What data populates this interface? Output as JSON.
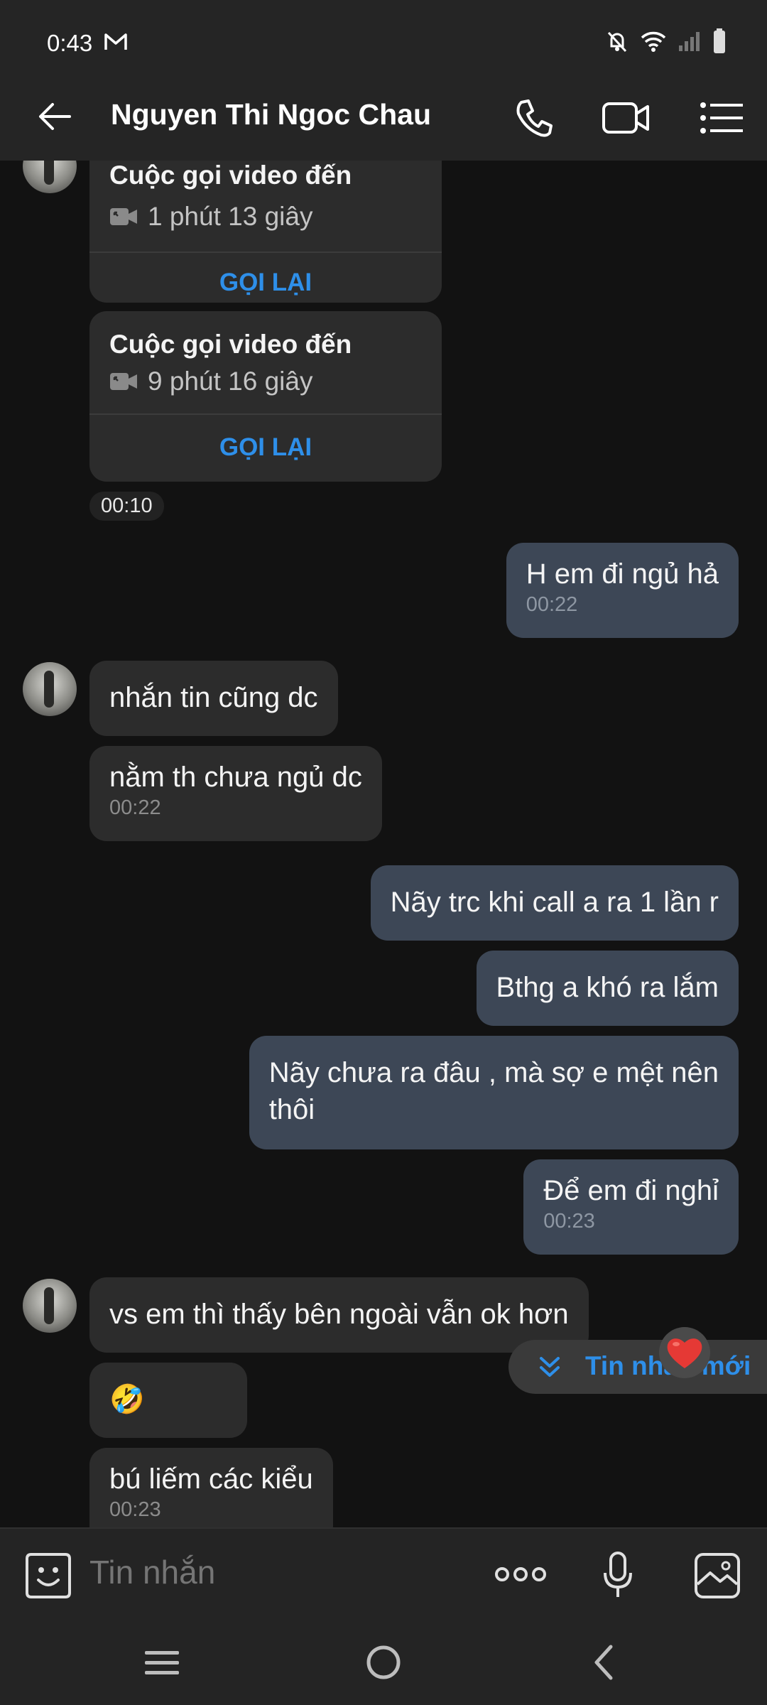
{
  "status": {
    "time": "0:43"
  },
  "header": {
    "contact_name": "Nguyen Thi Ngoc Chau"
  },
  "calls": [
    {
      "title": "Cuộc gọi video đến",
      "duration": "1 phút 13 giây",
      "action": "GỌI LẠI"
    },
    {
      "title": "Cuộc gọi video đến",
      "duration": "9 phút 16 giây",
      "action": "GỌI LẠI"
    }
  ],
  "call_time": "00:10",
  "messages": [
    {
      "text": "H em đi ngủ hả",
      "time": "00:22"
    },
    {
      "text": "nhắn tin cũng dc"
    },
    {
      "text": "nằm th chưa ngủ dc",
      "time": "00:22"
    },
    {
      "text": "Nãy trc khi call a ra 1 lần r"
    },
    {
      "text": "Bthg a khó ra lắm"
    },
    {
      "text": "Nãy chưa ra đâu , mà sợ e mệt nên",
      "text2": "thôi"
    },
    {
      "text": "Để em đi nghỉ",
      "time": "00:23"
    },
    {
      "text": "vs em thì thấy bên ngoài vẫn ok hơn"
    },
    {
      "text": "🤣"
    },
    {
      "text": "bú liếm các kiểu",
      "time": "00:23"
    }
  ],
  "new_message_button": "Tin nhắn mới",
  "composer": {
    "placeholder": "Tin nhắn"
  },
  "icons": {
    "back": "arrow-left-icon",
    "call": "phone-icon",
    "video": "video-camera-icon",
    "menu": "list-menu-icon",
    "sticker": "smiley-sticker-icon",
    "more": "more-options-icon",
    "mic": "microphone-icon",
    "gallery": "image-gallery-icon"
  },
  "colors": {
    "accent": "#2e8fe9",
    "outgoing_bubble": "#3d4756",
    "incoming_bubble": "#2c2c2c",
    "background": "#121212"
  }
}
